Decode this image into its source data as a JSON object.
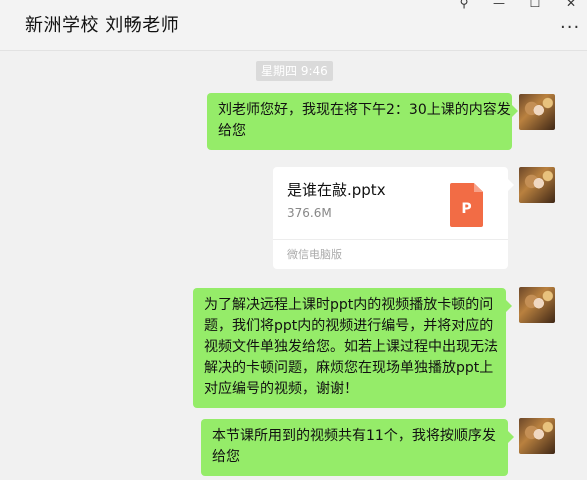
{
  "window": {
    "title": "新洲学校 刘畅老师",
    "controls": {
      "pin": "⚲",
      "minimize": "—",
      "maximize": "☐",
      "close": "✕"
    },
    "more_icon": "···"
  },
  "chat": {
    "timestamp": "星期四 9:46",
    "messages": [
      {
        "type": "text",
        "text": "刘老师您好，我现在将下午2：30上课的内容发给您"
      },
      {
        "type": "file",
        "name": "是谁在敲.pptx",
        "size": "376.6M",
        "source": "微信电脑版",
        "icon_letter": "P"
      },
      {
        "type": "text",
        "text": "为了解决远程上课时ppt内的视频播放卡顿的问题，我们将ppt内的视频进行编号，并将对应的视频文件单独发给您。如若上课过程中出现无法解决的卡顿问题，麻烦您在现场单独播放ppt上对应编号的视频，谢谢！"
      },
      {
        "type": "text",
        "text": "本节课所用到的视频共有11个，我将按顺序发给您"
      }
    ]
  },
  "colors": {
    "bubble": "#95ec69",
    "background": "#f1f1f1",
    "ppt_icon": "#f26c45"
  }
}
